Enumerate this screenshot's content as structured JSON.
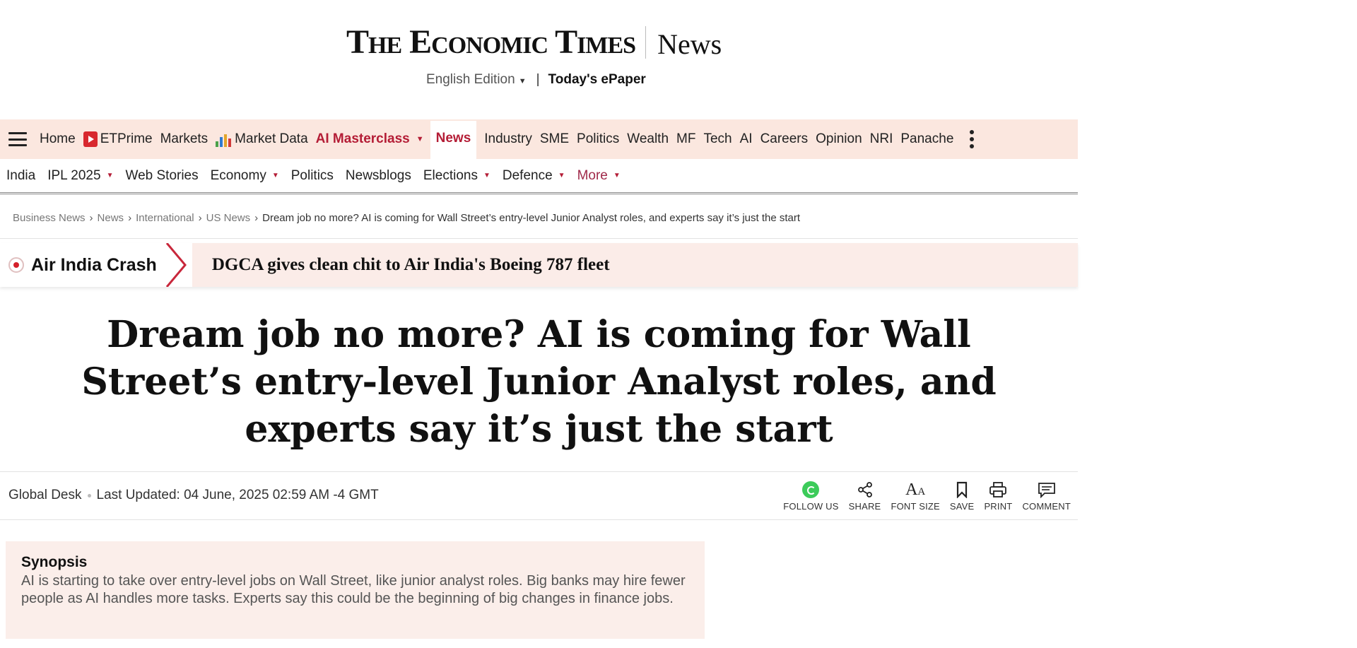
{
  "masthead": {
    "logo": "The Economic Times",
    "section": "News",
    "edition_label": "English Edition",
    "epaper_label": "Today's ePaper"
  },
  "main_nav": {
    "items": [
      {
        "label": "Home"
      },
      {
        "label": "ETPrime"
      },
      {
        "label": "Markets"
      },
      {
        "label": "Market Data"
      },
      {
        "label": "AI Masterclass"
      },
      {
        "label": "News"
      },
      {
        "label": "Industry"
      },
      {
        "label": "SME"
      },
      {
        "label": "Politics"
      },
      {
        "label": "Wealth"
      },
      {
        "label": "MF"
      },
      {
        "label": "Tech"
      },
      {
        "label": "AI"
      },
      {
        "label": "Careers"
      },
      {
        "label": "Opinion"
      },
      {
        "label": "NRI"
      },
      {
        "label": "Panache"
      }
    ],
    "active": "News",
    "accent_color": "#b41d36",
    "background_color": "#fbe7df"
  },
  "sub_nav": {
    "items": [
      {
        "label": "India"
      },
      {
        "label": "IPL 2025"
      },
      {
        "label": "Web Stories"
      },
      {
        "label": "Economy"
      },
      {
        "label": "Politics"
      },
      {
        "label": "Newsblogs"
      },
      {
        "label": "Elections"
      },
      {
        "label": "Defence"
      },
      {
        "label": "More"
      }
    ]
  },
  "breadcrumb": [
    {
      "label": "Business News"
    },
    {
      "label": "News"
    },
    {
      "label": "International"
    },
    {
      "label": "US News"
    },
    {
      "label": "Dream job no more? AI is coming for Wall Street’s entry-level Junior Analyst roles, and experts say it’s just the start"
    }
  ],
  "banner": {
    "label": "Air India Crash",
    "headline": "DGCA gives clean chit to Air India's Boeing 787 fleet"
  },
  "article": {
    "headline": "Dream job no more? AI is coming for Wall Street’s entry-level Junior Analyst roles, and experts say it’s just the start",
    "author": "Global Desk",
    "updated": "Last Updated: 04 June, 2025 02:59 AM -4 GMT"
  },
  "tools": [
    {
      "label": "FOLLOW US",
      "icon": "whatsapp-icon"
    },
    {
      "label": "SHARE",
      "icon": "share-icon"
    },
    {
      "label": "FONT SIZE",
      "icon": "font-size-icon"
    },
    {
      "label": "SAVE",
      "icon": "bookmark-icon"
    },
    {
      "label": "PRINT",
      "icon": "print-icon"
    },
    {
      "label": "COMMENT",
      "icon": "comment-icon"
    }
  ],
  "synopsis": {
    "title": "Synopsis",
    "body": "AI is starting to take over entry-level jobs on Wall Street, like junior analyst roles. Big banks may hire fewer people as AI handles more tasks. Experts say this could be the beginning of big changes in finance jobs."
  }
}
